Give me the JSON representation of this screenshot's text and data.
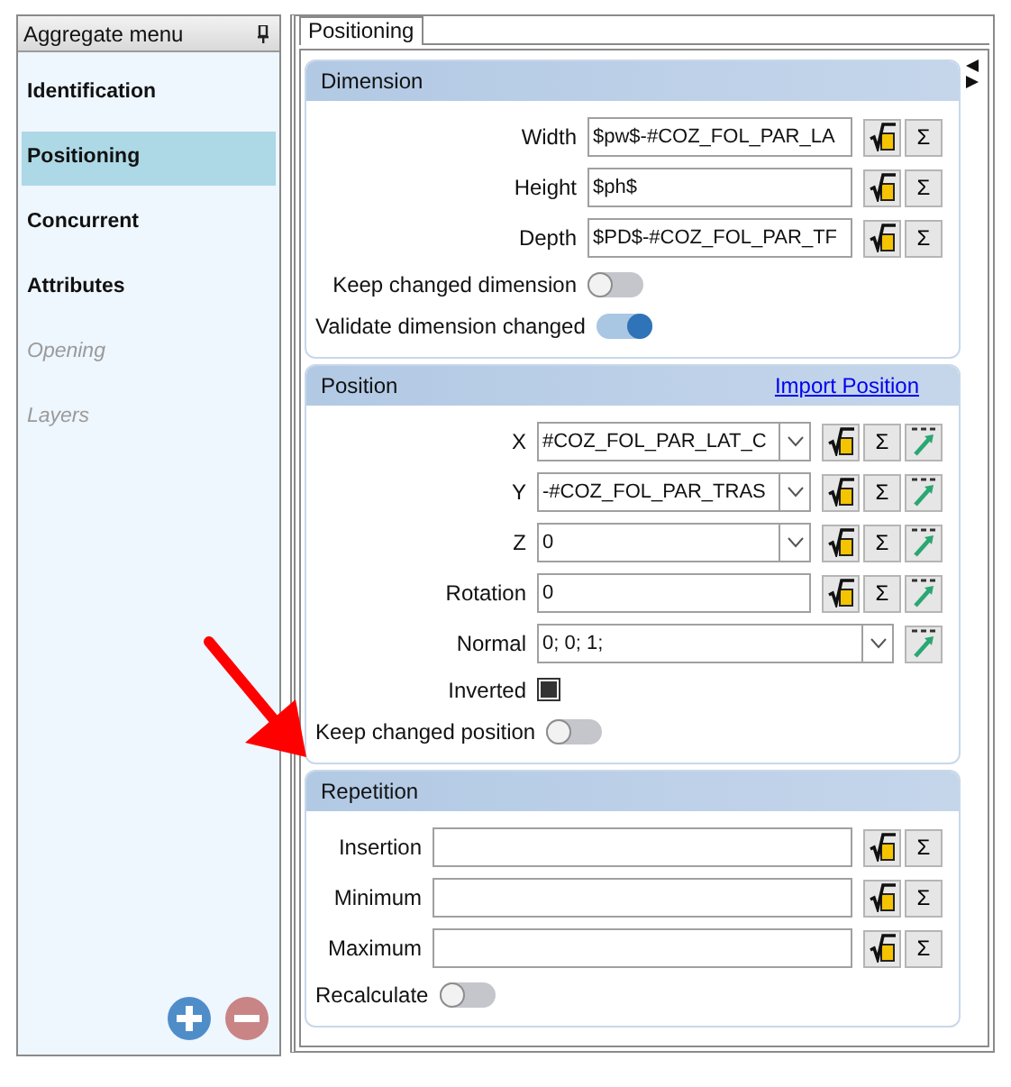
{
  "sidebar": {
    "title": "Aggregate menu",
    "items": [
      {
        "label": "Identification",
        "selected": false,
        "disabled": false
      },
      {
        "label": "Positioning",
        "selected": true,
        "disabled": false
      },
      {
        "label": "Concurrent",
        "selected": false,
        "disabled": false
      },
      {
        "label": "Attributes",
        "selected": false,
        "disabled": false
      },
      {
        "label": "Opening",
        "selected": false,
        "disabled": true
      },
      {
        "label": "Layers",
        "selected": false,
        "disabled": true
      }
    ]
  },
  "tabs": [
    {
      "label": "Positioning",
      "selected": true
    }
  ],
  "sections": [
    {
      "title": "Dimension",
      "rows": [
        {
          "kind": "field",
          "label": "Width",
          "value": "$pw$-#COZ_FOL_PAR_LA",
          "dropdown": false,
          "buttons": [
            {
              "kind": "formula"
            },
            {
              "kind": "sum",
              "text": "Σ"
            }
          ]
        },
        {
          "kind": "field",
          "label": "Height",
          "value": "$ph$",
          "dropdown": false,
          "buttons": [
            {
              "kind": "formula"
            },
            {
              "kind": "sum",
              "text": "Σ"
            }
          ]
        },
        {
          "kind": "field",
          "label": "Depth",
          "value": "$PD$-#COZ_FOL_PAR_TF",
          "dropdown": false,
          "buttons": [
            {
              "kind": "formula"
            },
            {
              "kind": "sum",
              "text": "Σ"
            }
          ]
        },
        {
          "kind": "toggle",
          "label": "Keep changed dimension",
          "on": false
        },
        {
          "kind": "toggle",
          "label": "Validate dimension changed",
          "on": true
        }
      ]
    },
    {
      "title": "Position",
      "link": "Import Position",
      "rows": [
        {
          "kind": "field",
          "label": "X",
          "value": "#COZ_FOL_PAR_LAT_C",
          "dropdown": true,
          "buttons": [
            {
              "kind": "formula"
            },
            {
              "kind": "sum",
              "text": "Σ"
            },
            {
              "kind": "xyz"
            }
          ]
        },
        {
          "kind": "field",
          "label": "Y",
          "value": "-#COZ_FOL_PAR_TRAS",
          "dropdown": true,
          "buttons": [
            {
              "kind": "formula"
            },
            {
              "kind": "sum",
              "text": "Σ"
            },
            {
              "kind": "xyz"
            }
          ]
        },
        {
          "kind": "field",
          "label": "Z",
          "value": "0",
          "dropdown": true,
          "buttons": [
            {
              "kind": "formula"
            },
            {
              "kind": "sum",
              "text": "Σ"
            },
            {
              "kind": "xyz"
            }
          ]
        },
        {
          "kind": "field",
          "label": "Rotation",
          "value": "0",
          "dropdown": false,
          "buttons": [
            {
              "kind": "formula"
            },
            {
              "kind": "sum",
              "text": "Σ"
            },
            {
              "kind": "xyz"
            }
          ]
        },
        {
          "kind": "field",
          "label": "Normal",
          "value": "0; 0; 1;",
          "dropdown": true,
          "buttons": [
            {
              "kind": "xyz"
            }
          ]
        },
        {
          "kind": "checkbox",
          "label": "Inverted",
          "checked": true
        },
        {
          "kind": "toggle",
          "label": "Keep changed position",
          "on": false
        }
      ]
    },
    {
      "title": "Repetition",
      "rows": [
        {
          "kind": "field",
          "label": "Insertion",
          "dropdown": false,
          "buttons": [
            {
              "kind": "formula"
            },
            {
              "kind": "sum",
              "text": "Σ"
            }
          ]
        },
        {
          "kind": "field",
          "label": "Minimum",
          "dropdown": false,
          "buttons": [
            {
              "kind": "formula"
            },
            {
              "kind": "sum",
              "text": "Σ"
            }
          ]
        },
        {
          "kind": "field",
          "label": "Maximum",
          "dropdown": false,
          "buttons": [
            {
              "kind": "formula"
            },
            {
              "kind": "sum",
              "text": "Σ"
            }
          ]
        },
        {
          "kind": "toggle",
          "label": "Recalculate",
          "on": false
        }
      ]
    }
  ]
}
